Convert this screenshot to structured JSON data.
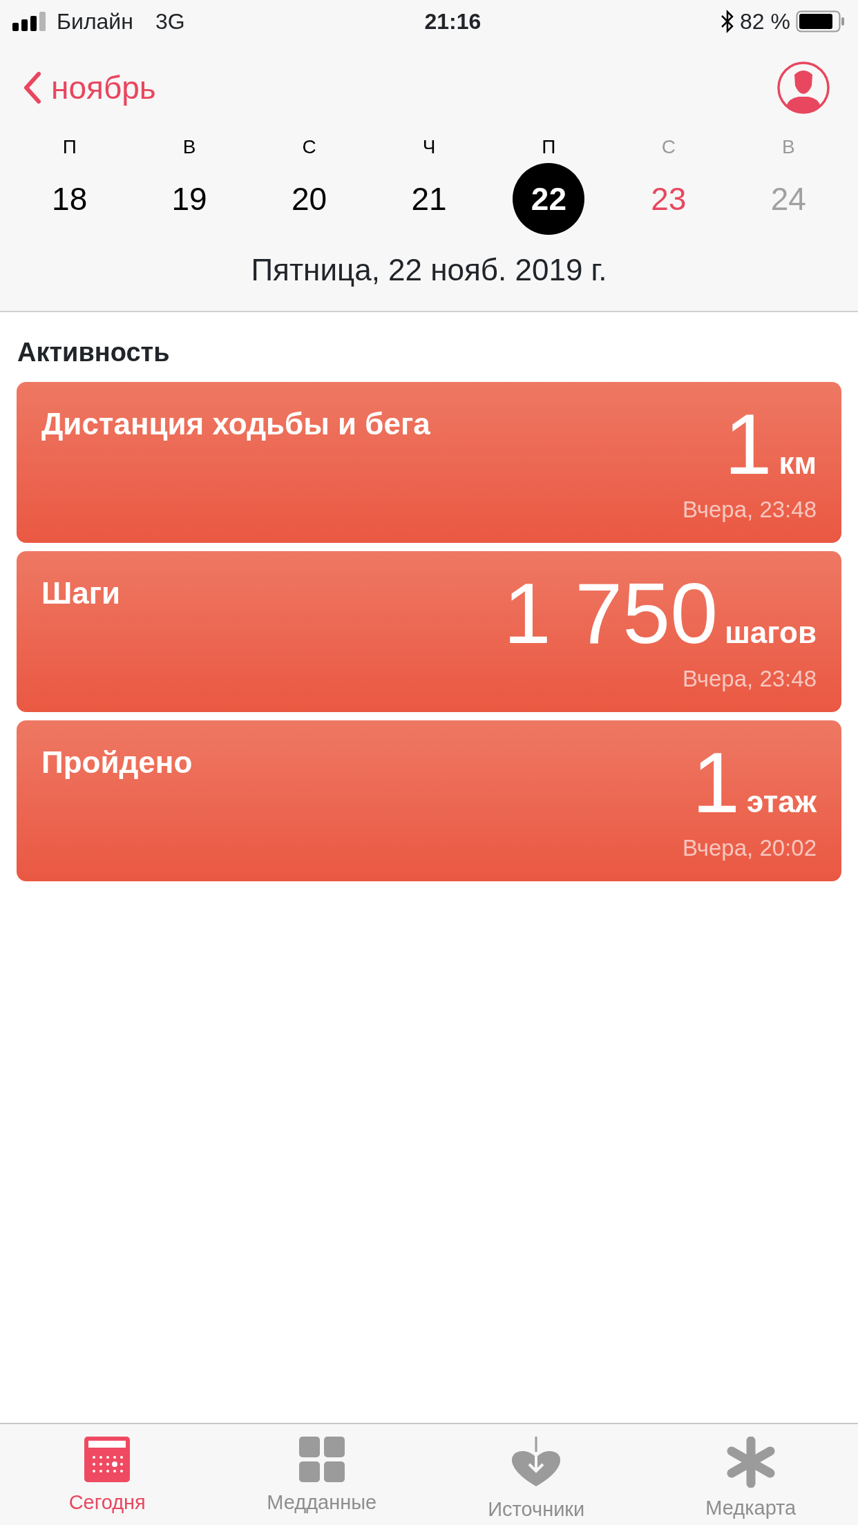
{
  "status_bar": {
    "carrier": "Билайн",
    "network": "3G",
    "time": "21:16",
    "battery": "82 %"
  },
  "nav": {
    "back_label": "ноябрь"
  },
  "week": [
    {
      "weekday": "П",
      "date": "18",
      "selected": false,
      "kind": "past"
    },
    {
      "weekday": "В",
      "date": "19",
      "selected": false,
      "kind": "past"
    },
    {
      "weekday": "С",
      "date": "20",
      "selected": false,
      "kind": "past"
    },
    {
      "weekday": "Ч",
      "date": "21",
      "selected": false,
      "kind": "past"
    },
    {
      "weekday": "П",
      "date": "22",
      "selected": true,
      "kind": "past"
    },
    {
      "weekday": "С",
      "date": "23",
      "selected": false,
      "kind": "today"
    },
    {
      "weekday": "В",
      "date": "24",
      "selected": false,
      "kind": "future"
    }
  ],
  "selected_date": "Пятница, 22 нояб. 2019 г.",
  "section_title": "Активность",
  "cards": [
    {
      "title": "Дистанция ходьбы и бега",
      "value": "1",
      "unit": "км",
      "time": "Вчера, 23:48"
    },
    {
      "title": "Шаги",
      "value": "1 750",
      "unit": "шагов",
      "time": "Вчера, 23:48"
    },
    {
      "title": "Пройдено",
      "value": "1",
      "unit": "этаж",
      "time": "Вчера, 20:02"
    }
  ],
  "tabs": [
    {
      "label": "Сегодня",
      "kind": "today",
      "selected": true
    },
    {
      "label": "Медданные",
      "kind": "data",
      "selected": false
    },
    {
      "label": "Источники",
      "kind": "sources",
      "selected": false
    },
    {
      "label": "Медкарта",
      "kind": "medical",
      "selected": false
    }
  ]
}
